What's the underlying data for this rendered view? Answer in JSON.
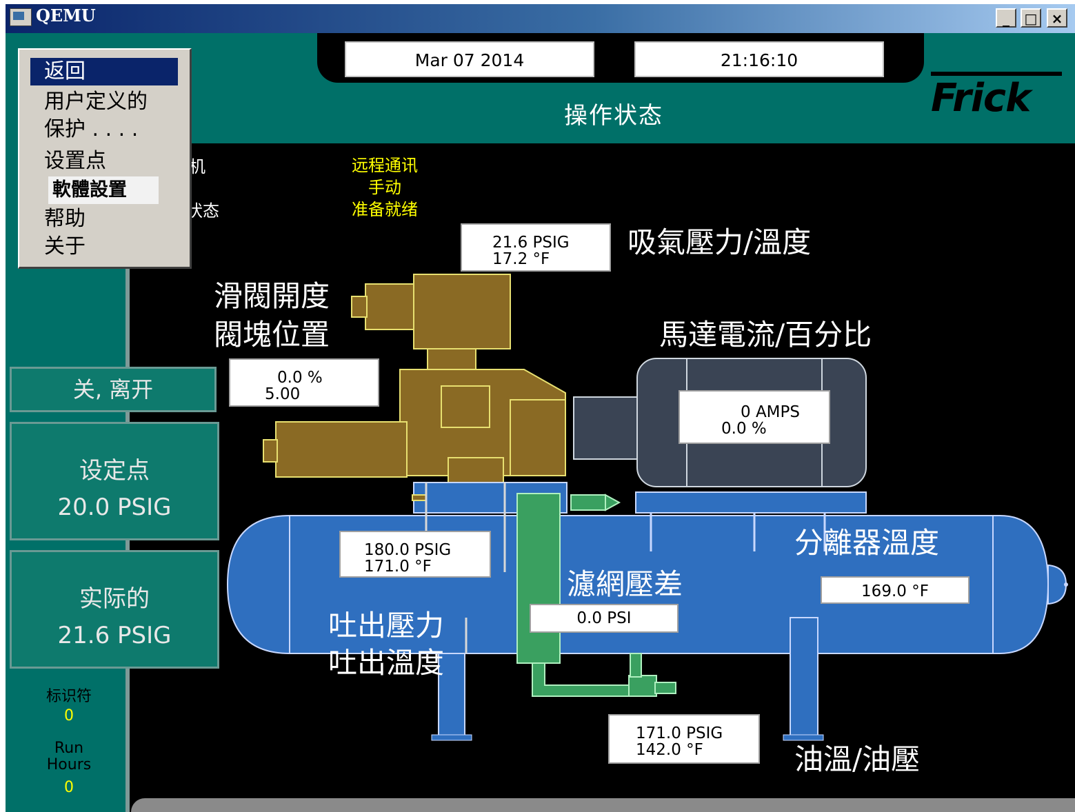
{
  "window": {
    "title": "QEMU",
    "minimize": "_",
    "maximize": "□",
    "close": "×"
  },
  "header": {
    "date": "Mar 07 2014",
    "time": "21:16:10",
    "title": "操作状态",
    "brand": "Frick"
  },
  "menu": {
    "items": [
      "返回",
      "用户定义的",
      "保护 . . . .",
      "设置点",
      "軟體設置",
      "帮助",
      "关于"
    ]
  },
  "status": {
    "partial_1": "机",
    "partial_2": "状态",
    "lines": [
      "远程通讯",
      "手动",
      "准备就绪"
    ]
  },
  "left_panel": {
    "mode_button": "关, 离开",
    "setpoint_label": "设定点",
    "setpoint_value": "20.0 PSIG",
    "actual_label": "实际的",
    "actual_value": "21.6 PSIG",
    "id_label": "标识符",
    "id_value": "0",
    "run_hours_label_1": "Run",
    "run_hours_label_2": "Hours",
    "run_hours_value": "0"
  },
  "readings": {
    "suction": {
      "pressure": "21.6 PSIG",
      "temp": "17.2 °F",
      "label": "吸氣壓力/溫度"
    },
    "slide_valve": {
      "percent": "0.0 %",
      "position": "5.00",
      "label_1": "滑閥開度",
      "label_2": "閥塊位置"
    },
    "motor": {
      "amps": "0 AMPS",
      "percent": "0.0 %",
      "label": "馬達電流/百分比"
    },
    "discharge": {
      "pressure": "180.0 PSIG",
      "temp": "171.0 °F",
      "label_1": "吐出壓力",
      "label_2": "吐出溫度"
    },
    "filter": {
      "value": "0.0 PSI",
      "label": "濾網壓差"
    },
    "separator": {
      "temp": "169.0 °F",
      "label": "分離器溫度"
    },
    "oil": {
      "pressure": "171.0 PSIG",
      "temp": "142.0 °F",
      "label": "油溫/油壓"
    }
  },
  "colors": {
    "teal": "#007068",
    "vessel_blue": "#2f6fbf",
    "compressor_brown": "#8a6a24",
    "motor_gray": "#3a4454",
    "pipe_green": "#3aa060",
    "status_yellow": "#ffff00"
  }
}
